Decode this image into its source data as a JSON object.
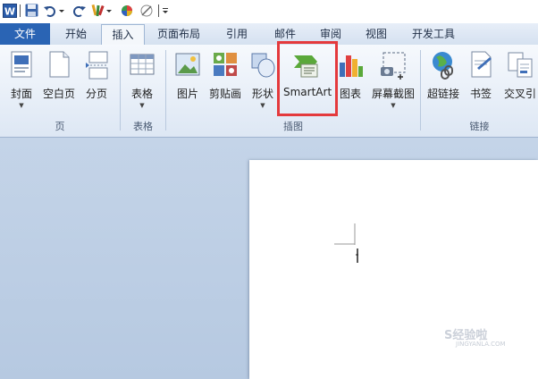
{
  "ribbon": {
    "tabs": [
      "文件",
      "开始",
      "插入",
      "页面布局",
      "引用",
      "邮件",
      "审阅",
      "视图",
      "开发工具"
    ],
    "groups": {
      "page": {
        "name": "页",
        "buttons": [
          "封面",
          "空白页",
          "分页"
        ]
      },
      "table": {
        "name": "表格",
        "buttons": [
          "表格"
        ]
      },
      "illustrations": {
        "name": "插图",
        "buttons": [
          "图片",
          "剪贴画",
          "形状",
          "SmartArt",
          "图表",
          "屏幕截图"
        ]
      },
      "links": {
        "name": "链接",
        "buttons": [
          "超链接",
          "书签",
          "交叉引"
        ]
      }
    }
  },
  "watermark": {
    "text": "S经验啦",
    "sub": "JINGYANLA.COM"
  },
  "colors": {
    "file_tab": "#2a64b4",
    "highlight": "#e4393c",
    "workspace": "#b6c9e1"
  }
}
